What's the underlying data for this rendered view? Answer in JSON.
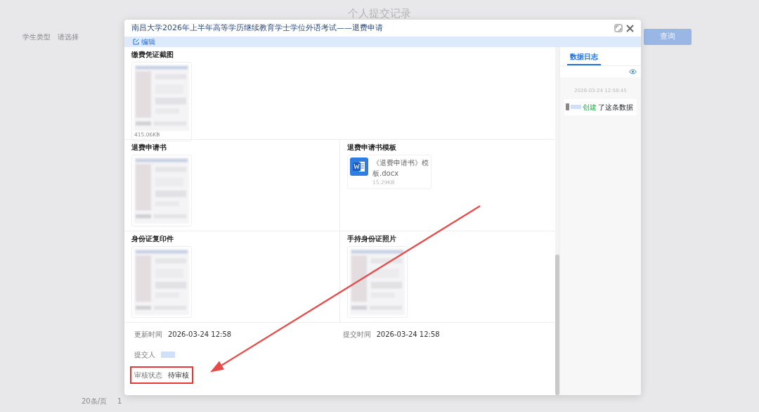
{
  "page": {
    "title": "个人提交记录",
    "filter_label": "学生类型",
    "filter_placeholder": "请选择",
    "query_button": "查询",
    "page_size": "20条/页",
    "page_number": "1"
  },
  "modal": {
    "title": "南昌大学2026年上半年高等学历继续教育学士学位外语考试——退费申请",
    "edit_button": "编辑",
    "rows": [
      [
        {
          "label": "缴费凭证截图",
          "size": "415.06KB"
        }
      ],
      [
        {
          "label": "退费申请书"
        },
        {
          "label": "退费申请书模板",
          "kind": "file",
          "file_name": "《退费申请书》模板.docx",
          "size": "15.29KB"
        }
      ],
      [
        {
          "label": "身份证复印件"
        },
        {
          "label": "手持身份证照片"
        }
      ]
    ],
    "meta": [
      {
        "label": "更新时间",
        "value": "2026-03-24 12:58",
        "kind": "text",
        "highlighted": false
      },
      {
        "label": "提交时间",
        "value": "2026-03-24 12:58",
        "kind": "text",
        "highlighted": false
      },
      {
        "label": "提交人",
        "kind": "redacted",
        "highlighted": false
      },
      {
        "label": "审核状态",
        "value": "待审核",
        "kind": "text",
        "highlighted": true
      }
    ],
    "log_tabs": [
      {
        "label": "数据日志",
        "selected": true
      }
    ],
    "log": [
      {
        "time": "2026-03-24 12:58:45",
        "action": "创建",
        "text": "了这条数据"
      }
    ]
  }
}
